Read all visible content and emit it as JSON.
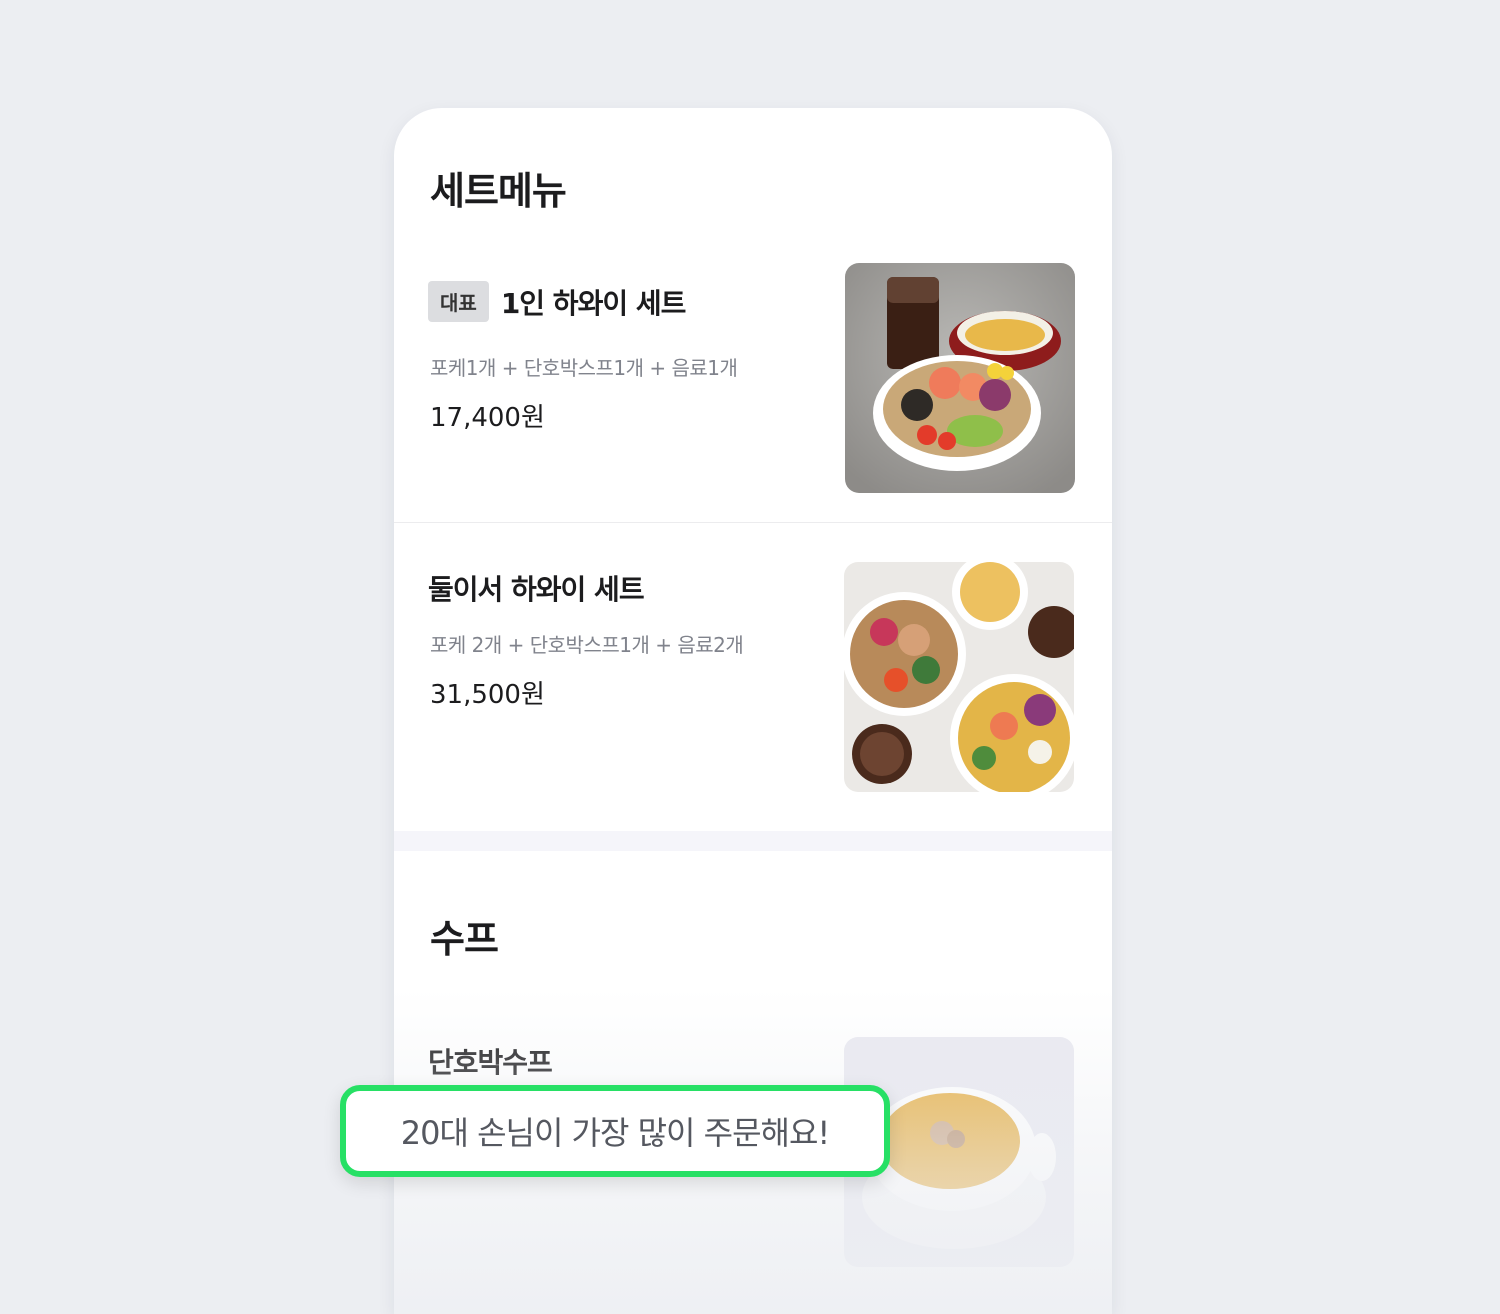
{
  "sections": [
    {
      "title": "세트메뉴",
      "items": [
        {
          "badge": "대표",
          "name": "1인 하와이 세트",
          "desc": "포케1개 + 단호박스프1개 + 음료1개",
          "price": "17,400원",
          "image_icon": "poke-set-photo-icon"
        },
        {
          "name": "둘이서 하와이 세트",
          "desc": "포케 2개 + 단호박스프1개 + 음료2개",
          "price": "31,500원",
          "image_icon": "poke-duo-set-photo-icon"
        }
      ]
    },
    {
      "title": "수프",
      "items": [
        {
          "name": "단호박수프",
          "image_icon": "pumpkin-soup-photo-icon"
        }
      ]
    }
  ],
  "tooltip": {
    "text": "20대 손님이 가장 많이 주문해요!"
  },
  "colors": {
    "background": "#eceef2",
    "card": "#ffffff",
    "badge_bg": "#dcdde0",
    "tooltip_border": "#27e065",
    "description": "#80838c"
  }
}
